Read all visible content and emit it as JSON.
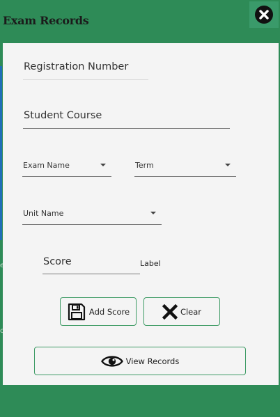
{
  "window": {
    "title": "Exam Records"
  },
  "form": {
    "registration_number": {
      "placeholder": "Registration Number"
    },
    "student_course": {
      "placeholder": "Student Course"
    },
    "exam_name": {
      "placeholder": "Exam Name"
    },
    "term": {
      "placeholder": "Term"
    },
    "unit_name": {
      "placeholder": "Unit Name"
    },
    "score": {
      "placeholder": "Score"
    },
    "score_label": "Label"
  },
  "buttons": {
    "add_score": "Add Score",
    "clear": "Clear",
    "view_records": "View Records"
  },
  "icons": {
    "close": "close-circle-icon",
    "add_score": "floppy-disk-icon",
    "clear": "x-mark-icon",
    "view_records": "eye-icon"
  },
  "colors": {
    "background": "#2e8b57",
    "panel": "#f4f4f4",
    "button_border": "#3c9a63"
  }
}
